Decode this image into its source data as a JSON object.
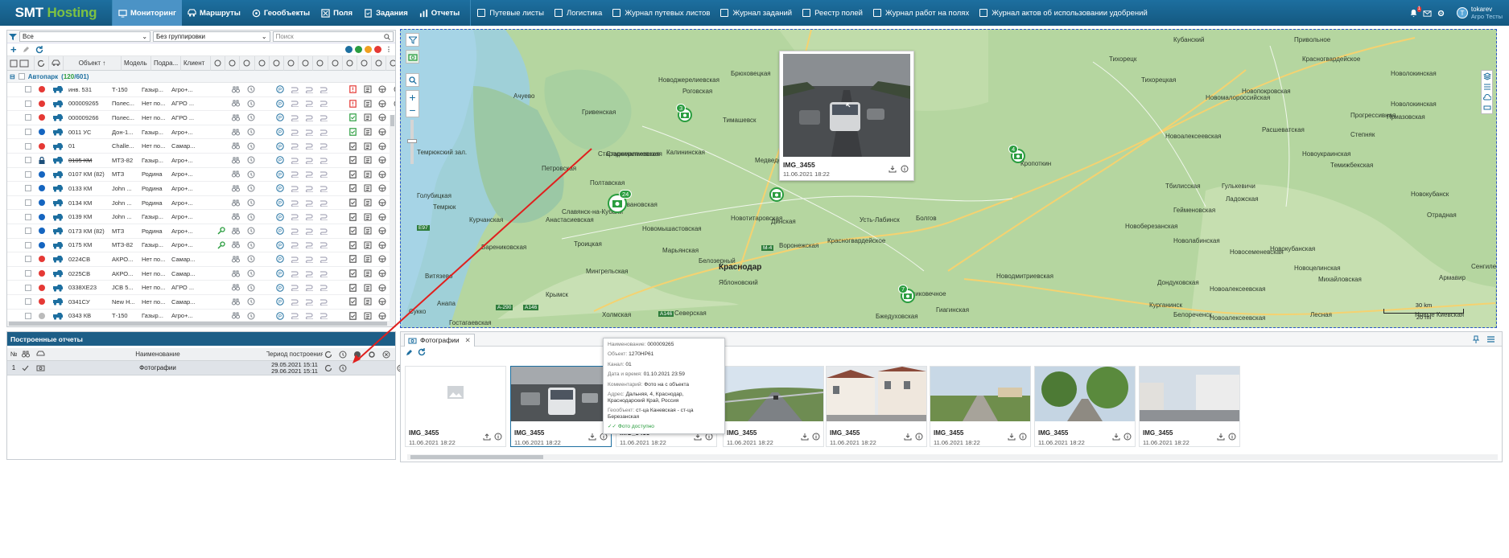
{
  "brand": {
    "part1": "SMT",
    "part2": "Hosting"
  },
  "modules": [
    {
      "label": "Мониторинг",
      "icon": "monitor-icon",
      "active": true
    },
    {
      "label": "Маршруты",
      "icon": "route-icon",
      "active": false
    },
    {
      "label": "Геообъекты",
      "icon": "geo-icon",
      "active": false
    },
    {
      "label": "Поля",
      "icon": "field-icon",
      "active": false
    },
    {
      "label": "Задания",
      "icon": "task-icon",
      "active": false
    },
    {
      "label": "Отчеты",
      "icon": "report-icon",
      "active": false
    }
  ],
  "journals": [
    "Путевые листы",
    "Логистика",
    "Журнал путевых листов",
    "Журнал заданий",
    "Реестр полей",
    "Журнал работ на полях",
    "Журнал актов об использовании удобрений"
  ],
  "user": {
    "name": "tokarev",
    "org": "Агро Тесты",
    "initial": "T",
    "notif_count": "1"
  },
  "filters": {
    "status": "Все",
    "grouping": "Без группировки",
    "search_placeholder": "Поиск"
  },
  "columns": {
    "object": "Объект",
    "model": "Модель",
    "division": "Подра...",
    "client": "Клиент"
  },
  "group": {
    "label": "Автопарк",
    "count_online": "120",
    "count_total": "601"
  },
  "vehicles": [
    {
      "name": "инв. 531",
      "model": "Т-150",
      "div": "Газыр...",
      "client": "Агро+...",
      "status": "red",
      "doc": "red"
    },
    {
      "name": "000009265",
      "model": "Полес...",
      "div": "Нет по...",
      "client": "АГРО ...",
      "status": "red",
      "doc": "red"
    },
    {
      "name": "000009266",
      "model": "Полес...",
      "div": "Нет по...",
      "client": "АГРО ...",
      "status": "red",
      "doc": "green"
    },
    {
      "name": "0011 УС",
      "model": "Дон-1...",
      "div": "Газыр...",
      "client": "Агро+...",
      "status": "blue",
      "doc": "green"
    },
    {
      "name": "01",
      "model": "Challe...",
      "div": "Нет по...",
      "client": "Самар...",
      "status": "red",
      "doc": "none"
    },
    {
      "name": "0105 КМ",
      "model": "МТЗ-82",
      "div": "Газыр...",
      "client": "Агро+...",
      "status": "lock",
      "doc": "none"
    },
    {
      "name": "0107 КМ (82)",
      "model": "МТЗ",
      "div": "Родина",
      "client": "Агро+...",
      "status": "blue",
      "doc": "none"
    },
    {
      "name": "0133 КМ",
      "model": "John ...",
      "div": "Родина",
      "client": "Агро+...",
      "status": "blue",
      "doc": "none"
    },
    {
      "name": "0134 КМ",
      "model": "John ...",
      "div": "Родина",
      "client": "Агро+...",
      "status": "blue",
      "doc": "none"
    },
    {
      "name": "0139 КМ",
      "model": "John ...",
      "div": "Газыр...",
      "client": "Агро+...",
      "status": "blue",
      "doc": "none"
    },
    {
      "name": "0173 КМ (82)",
      "model": "МТЗ",
      "div": "Родина",
      "client": "Агро+...",
      "status": "blue",
      "doc": "none"
    },
    {
      "name": "0175 КМ",
      "model": "МТЗ-82",
      "div": "Газыр...",
      "client": "Агро+...",
      "status": "blue",
      "doc": "none"
    },
    {
      "name": "0224СВ",
      "model": "АКРО...",
      "div": "Нет по...",
      "client": "Самар...",
      "status": "red",
      "doc": "none"
    },
    {
      "name": "0225СВ",
      "model": "АКРО...",
      "div": "Нет по...",
      "client": "Самар...",
      "status": "red",
      "doc": "none"
    },
    {
      "name": "0338ХЕ23",
      "model": "JCB 5...",
      "div": "Нет по...",
      "client": "АГРО ...",
      "status": "red",
      "doc": "none"
    },
    {
      "name": "0341СУ",
      "model": "New H...",
      "div": "Нет по...",
      "client": "Самар...",
      "status": "red",
      "doc": "none"
    },
    {
      "name": "0343 КВ",
      "model": "Т-150",
      "div": "Газыр...",
      "client": "Агро+...",
      "status": "grey",
      "doc": "none"
    }
  ],
  "map": {
    "labels": [
      {
        "t": "Кубанский"
      },
      {
        "t": "Привольное"
      },
      {
        "t": "Тихорецк"
      },
      {
        "t": "Красногвардейское"
      },
      {
        "t": "Новолокинская"
      },
      {
        "t": "Новоджерелиевская"
      },
      {
        "t": "Брюховецкая"
      },
      {
        "t": "Роговская"
      },
      {
        "t": "Ачуево"
      },
      {
        "t": "Гривенская"
      },
      {
        "t": "Тимашевск"
      },
      {
        "t": "Тихорецкая"
      },
      {
        "t": "Новопокровская"
      },
      {
        "t": "Новолокинская"
      },
      {
        "t": "Приазовская"
      },
      {
        "t": "Новомалороссийская"
      },
      {
        "t": "Расшеватская"
      },
      {
        "t": "Степняк"
      },
      {
        "t": "Прогрессивная"
      },
      {
        "t": "Новоукраинская"
      },
      {
        "t": "Калининская"
      },
      {
        "t": "Новоалексеевская"
      },
      {
        "t": "Темижбекская"
      },
      {
        "t": "Темрюкский зал."
      },
      {
        "t": "Старомалиевская"
      },
      {
        "t": "Кропоткин"
      },
      {
        "t": "Петровская"
      },
      {
        "t": "Староджерелиевская"
      },
      {
        "t": "Медведовская"
      },
      {
        "t": "Тбилисская"
      },
      {
        "t": "Гулькевичи"
      },
      {
        "t": "Новокубанск"
      },
      {
        "t": "Голубицкая"
      },
      {
        "t": "Полтавская"
      },
      {
        "t": "Ивановская"
      },
      {
        "t": "Ладожская"
      },
      {
        "t": "Темрюк"
      },
      {
        "t": "Славянск-на-Кубани"
      },
      {
        "t": "Гейменовская"
      },
      {
        "t": "Курчанская"
      },
      {
        "t": "Анастасиевская"
      },
      {
        "t": "Новотитаровская"
      },
      {
        "t": "Динская"
      },
      {
        "t": "Усть-Лабинск"
      },
      {
        "t": "Болгов"
      },
      {
        "t": "Отрадная"
      },
      {
        "t": "Новоберезанская"
      },
      {
        "t": "Троицкая"
      },
      {
        "t": "Новомышастовская"
      },
      {
        "t": "Красногвардейское"
      },
      {
        "t": "Воронежская"
      },
      {
        "t": "Марьянская"
      },
      {
        "t": "Новолабинская"
      },
      {
        "t": "Варениковская"
      },
      {
        "t": "Мингрельская"
      },
      {
        "t": "Белозерный"
      },
      {
        "t": "Краснодар"
      },
      {
        "t": "Новосеменевская"
      },
      {
        "t": "Новокубанская"
      },
      {
        "t": "Сенгилеевское"
      },
      {
        "t": "Новоцелинская"
      },
      {
        "t": "Яблоновский"
      },
      {
        "t": "Дондуковская"
      },
      {
        "t": "Армавир"
      },
      {
        "t": "Витязево"
      },
      {
        "t": "Михайловская"
      },
      {
        "t": "Крымск"
      },
      {
        "t": "Новодмитриевская"
      },
      {
        "t": "Анапа"
      },
      {
        "t": "Холмская"
      },
      {
        "t": "Северская"
      },
      {
        "t": "Великовечное"
      },
      {
        "t": "Гиагинская"
      },
      {
        "t": "Курганинск"
      },
      {
        "t": "Новоалексеевская"
      },
      {
        "t": "Бжедуховская"
      },
      {
        "t": "Белореченск"
      },
      {
        "t": "Лесная"
      },
      {
        "t": "Новоалексеевская"
      },
      {
        "t": "Гостагаевская"
      },
      {
        "t": "Сукко"
      },
      {
        "t": "Новые Киевская"
      }
    ],
    "markers": [
      {
        "count": "3"
      },
      {
        "count": "24"
      },
      {
        "count": ""
      },
      {
        "count": "4"
      },
      {
        "count": "7"
      }
    ],
    "popup": {
      "title": "IMG_3455",
      "date": "11.06.2021 18:22"
    },
    "scale": {
      "km": "30 km",
      "mi": "20 mi"
    },
    "roads": [
      "E97",
      "A-290",
      "A146",
      "A146",
      "M-4"
    ]
  },
  "reports": {
    "title": "Построенные отчеты",
    "columns": {
      "num": "№",
      "name": "Наименование",
      "period": "Период построения"
    },
    "rows": [
      {
        "num": "1",
        "name": "Фотографии",
        "from": "29.05.2021 15:11",
        "to": "29.06.2021 15:11"
      }
    ]
  },
  "photos": {
    "tab": "Фотографии",
    "cards": [
      {
        "title": "IMG_3455",
        "date": "11.06.2021 18:22",
        "img": "placeholder"
      },
      {
        "title": "IMG_3455",
        "date": "11.06.2021 18:22",
        "img": "van"
      },
      {
        "title": "IMG_3455",
        "date": "11.06.2021 18:22",
        "img": "road"
      },
      {
        "title": "IMG_3455",
        "date": "11.06.2021 18:22",
        "img": "highway"
      },
      {
        "title": "IMG_3455",
        "date": "11.06.2021 18:22",
        "img": "houses"
      },
      {
        "title": "IMG_3455",
        "date": "11.06.2021 18:22",
        "img": "village"
      },
      {
        "title": "IMG_3455",
        "date": "11.06.2021 18:22",
        "img": "trees"
      },
      {
        "title": "IMG_3455",
        "date": "11.06.2021 18:22",
        "img": "street"
      }
    ],
    "tooltip": {
      "name_k": "Наименование:",
      "name_v": "000009265",
      "object_k": "Объект:",
      "object_v": "1270НР61",
      "channel_k": "Канал:",
      "channel_v": "01",
      "dt_k": "Дата и время:",
      "dt_v": "01.10.2021 23:59",
      "comment_k": "Комментарий:",
      "comment_v": "Фото на с объекта",
      "addr_k": "Адрес:",
      "addr_v": "Дальняя, 4, Краснодар, Краснодарский Край, Россия",
      "geo_k": "Геообъект:",
      "geo_v": "ст-ца Каневская - ст-ца Березанская",
      "status": "Фото доступно"
    }
  },
  "colors": {
    "header": "#1d6fa0",
    "active": "#4b93c6",
    "green": "#2a9d3f",
    "red": "#e53935",
    "blue": "#1565c0",
    "arrow": "#e0201e"
  }
}
